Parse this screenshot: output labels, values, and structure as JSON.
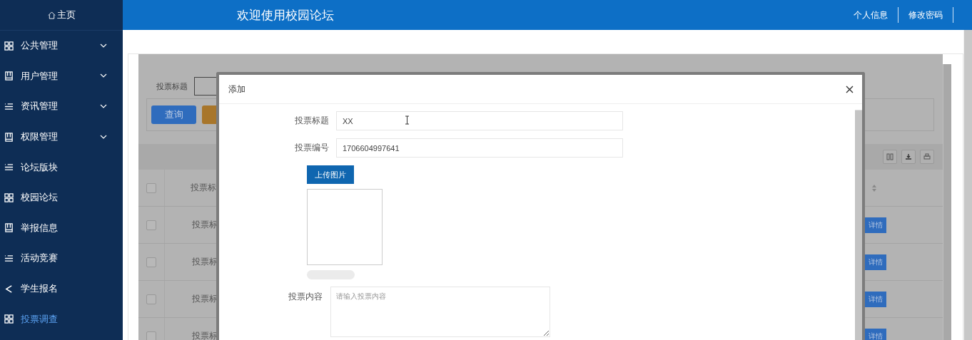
{
  "sidebar": {
    "home": "主页",
    "items": [
      {
        "label": "公共管理",
        "kind": "grid",
        "has_submenu": true,
        "selected": false
      },
      {
        "label": "用户管理",
        "kind": "book",
        "has_submenu": true,
        "selected": false
      },
      {
        "label": "资讯管理",
        "kind": "list",
        "has_submenu": true,
        "selected": false
      },
      {
        "label": "权限管理",
        "kind": "book",
        "has_submenu": true,
        "selected": false
      },
      {
        "label": "论坛版块",
        "kind": "list",
        "has_submenu": false,
        "selected": false
      },
      {
        "label": "校园论坛",
        "kind": "grid",
        "has_submenu": false,
        "selected": false
      },
      {
        "label": "举报信息",
        "kind": "book",
        "has_submenu": false,
        "selected": false
      },
      {
        "label": "活动竞赛",
        "kind": "list",
        "has_submenu": false,
        "selected": false
      },
      {
        "label": "学生报名",
        "kind": "share",
        "has_submenu": false,
        "selected": false
      },
      {
        "label": "投票调查",
        "kind": "grid",
        "has_submenu": false,
        "selected": true
      }
    ]
  },
  "header": {
    "title": "欢迎使用校园论坛",
    "links": [
      "个人信息",
      "修改密码"
    ]
  },
  "background_page": {
    "search": {
      "label": "投票标题"
    },
    "search_button": "查询",
    "table": {
      "column_1": "投票标",
      "all_checked": false,
      "rows": [
        {
          "title": "投票标",
          "checked": false,
          "action": "详情"
        },
        {
          "title": "投票标",
          "checked": false,
          "action": "详情"
        },
        {
          "title": "投票标",
          "checked": false,
          "action": "详情"
        },
        {
          "title": "投票标",
          "checked": false,
          "action": "详情"
        }
      ]
    }
  },
  "modal": {
    "title": "添加",
    "fields": [
      {
        "label": "投票标题",
        "value": "XX"
      },
      {
        "label": "投票编号",
        "value": "1706604997641"
      }
    ],
    "upload_button": "上传图片",
    "upload_progress": {
      "level": 0
    },
    "content": {
      "label": "投票内容",
      "placeholder": "请输入投票内容"
    }
  }
}
